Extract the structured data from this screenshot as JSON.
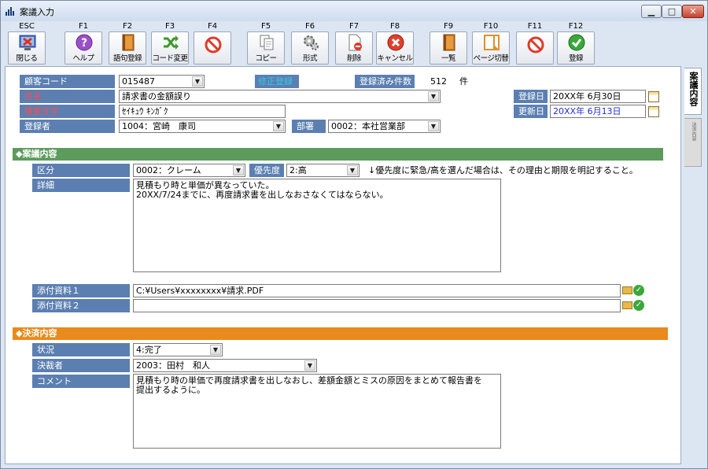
{
  "window": {
    "title": "案議入力",
    "min_label": "▁",
    "max_label": "□",
    "close_label": "✕"
  },
  "toolbar": [
    {
      "key": "ESC",
      "label": "閉じる",
      "icon": "close-window-icon"
    },
    {
      "key": "F1",
      "label": "ヘルプ",
      "icon": "help-icon"
    },
    {
      "key": "F2",
      "label": "語句登録",
      "icon": "book-icon"
    },
    {
      "key": "F3",
      "label": "コード変更",
      "icon": "shuffle-icon"
    },
    {
      "key": "F4",
      "label": "",
      "icon": "prohibited-icon"
    },
    {
      "key": "F5",
      "label": "コピー",
      "icon": "copy-icon"
    },
    {
      "key": "F6",
      "label": "形式",
      "icon": "gear-icon"
    },
    {
      "key": "F7",
      "label": "削除",
      "icon": "delete-icon"
    },
    {
      "key": "F8",
      "label": "キャンセル",
      "icon": "cancel-icon"
    },
    {
      "key": "F9",
      "label": "一覧",
      "icon": "list-book-icon"
    },
    {
      "key": "F10",
      "label": "ページ切替",
      "icon": "page-switch-icon"
    },
    {
      "key": "F11",
      "label": "",
      "icon": "prohibited-icon"
    },
    {
      "key": "F12",
      "label": "登録",
      "icon": "register-check-icon"
    }
  ],
  "header": {
    "customer_code_label": "顧客コード",
    "customer_code_value": "015487",
    "edit_register_label": "修正登録",
    "registered_count_label": "登録済み件数",
    "registered_count_value": "512",
    "registered_count_unit": "件",
    "subject_label": "件名",
    "subject_value": "請求書の金額誤り",
    "search_text_label": "検索文字",
    "search_text_value": "ｾｲｷｭｳ ｷﾝｶﾞｸ",
    "registrant_label": "登録者",
    "registrant_value": "1004：宮崎　康司",
    "department_label": "部署",
    "department_value": "0002：本社営業部",
    "registered_date_label": "登録日",
    "registered_date_value": "20XX年 6月30日",
    "updated_date_label": "更新日",
    "updated_date_value": "20XX年 6月13日"
  },
  "proposal": {
    "section_title": "◆案議内容",
    "category_label": "区分",
    "category_value": "0002：クレーム",
    "priority_label": "優先度",
    "priority_value": "2:高",
    "priority_note": "↓優先度に緊急/高を選んだ場合は、その理由と期限を明記すること。",
    "detail_label": "詳細",
    "detail_text": "見積もり時と単価が異なっていた。\n20XX/7/24までに、再度請求書を出しなおさなくてはならない。",
    "attachment1_label": "添付資料１",
    "attachment1_value": "C:¥Users¥xxxxxxxx¥請求.PDF",
    "attachment2_label": "添付資料２",
    "attachment2_value": ""
  },
  "decision": {
    "section_title": "◆決済内容",
    "status_label": "状況",
    "status_value": "4:完了",
    "approver_label": "決裁者",
    "approver_value": "2003：田村　和人",
    "comment_label": "コメント",
    "comment_text": "見積もり時の単価で再度請求書を出しなおし、差額金額とミスの原因をまとめて報告書を\n提出するように。"
  },
  "side_tabs": {
    "tab1": "案議内容",
    "tab2": "決済内容"
  },
  "colors": {
    "label_bg": "#5b7fb1",
    "section_green": "#5d9b5d",
    "section_orange": "#e98a1c",
    "required_red": "#ff4a4a"
  }
}
